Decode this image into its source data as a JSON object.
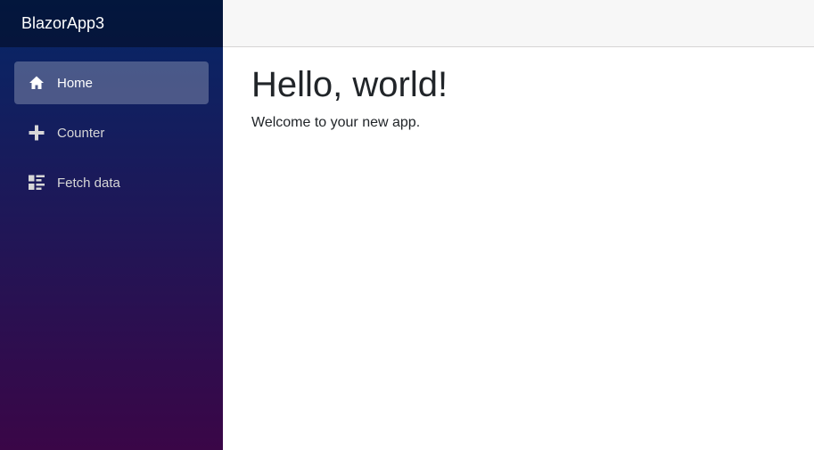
{
  "app": {
    "brand": "BlazorApp3"
  },
  "sidebar": {
    "items": [
      {
        "label": "Home",
        "icon": "home-icon",
        "active": true
      },
      {
        "label": "Counter",
        "icon": "plus-icon",
        "active": false
      },
      {
        "label": "Fetch data",
        "icon": "list-icon",
        "active": false
      }
    ]
  },
  "main": {
    "title": "Hello, world!",
    "text": "Welcome to your new app."
  },
  "colors": {
    "sidebar_top": "#052767",
    "sidebar_bottom": "#3a0647",
    "top_row": "#f7f7f7"
  }
}
